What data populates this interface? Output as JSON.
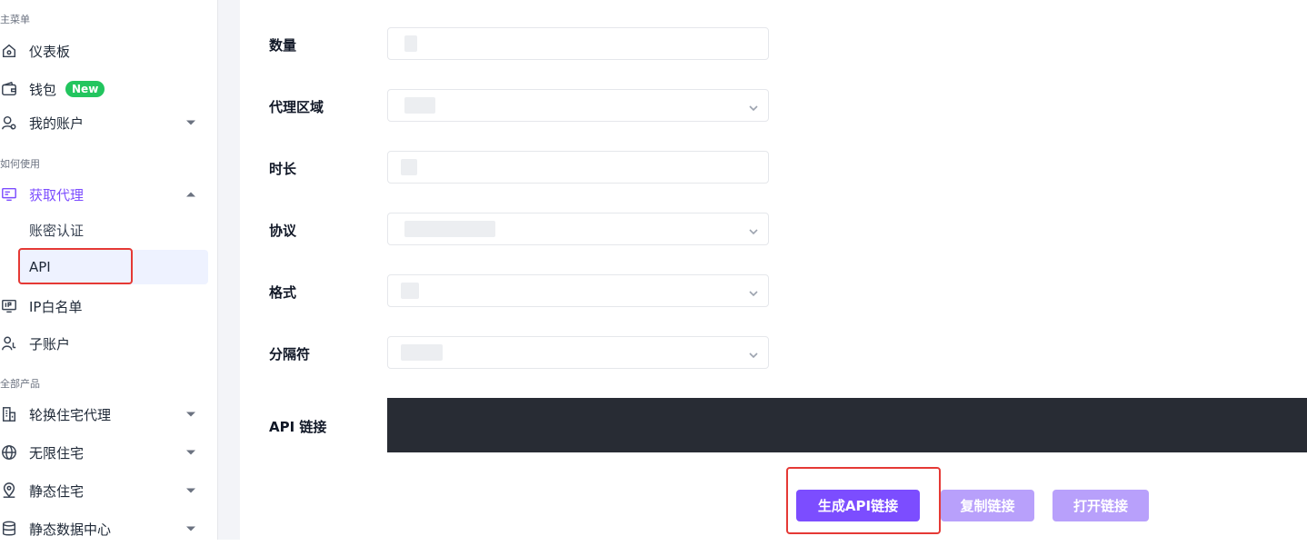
{
  "sidebar": {
    "sections": {
      "main_menu": "主菜单",
      "how_to_use": "如何使用",
      "all_products": "全部产品"
    },
    "items": {
      "dashboard": {
        "label": "仪表板",
        "icon": "home-icon"
      },
      "wallet": {
        "label": "钱包",
        "icon": "wallet-icon",
        "badge": "New"
      },
      "my_account": {
        "label": "我的账户",
        "icon": "user-icon"
      },
      "get_proxy": {
        "label": "获取代理",
        "icon": "monitor-icon"
      },
      "account_auth": {
        "label": "账密认证"
      },
      "api": {
        "label": "API"
      },
      "ip_whitelist": {
        "label": "IP白名单",
        "icon": "ip-icon"
      },
      "sub_account": {
        "label": "子账户",
        "icon": "sub-user-icon"
      },
      "rotating_residential": {
        "label": "轮换住宅代理",
        "icon": "building-icon"
      },
      "unlimited_residential": {
        "label": "无限住宅",
        "icon": "globe-icon"
      },
      "static_residential": {
        "label": "静态住宅",
        "icon": "location-icon"
      },
      "static_datacenter": {
        "label": "静态数据中心",
        "icon": "database-icon"
      }
    }
  },
  "form": {
    "quantity_label": "数量",
    "region_label": "代理区域",
    "duration_label": "时长",
    "protocol_label": "协议",
    "format_label": "格式",
    "separator_label": "分隔符",
    "api_link_label": "API 链接"
  },
  "buttons": {
    "generate": "生成API链接",
    "copy": "复制链接",
    "open": "打开链接"
  },
  "colors": {
    "accent": "#7c4dff",
    "accent_light": "#b8a0fb",
    "badge_green": "#22c55e",
    "highlight_red": "#e53935",
    "code_bg": "#282c34"
  }
}
